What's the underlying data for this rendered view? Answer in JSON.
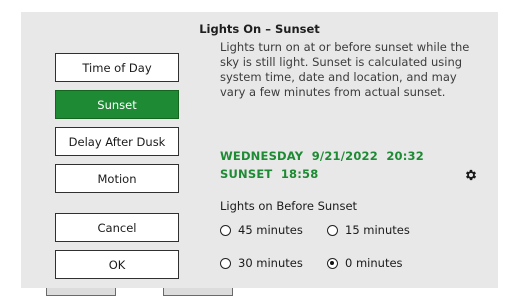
{
  "dialog": {
    "title": "Lights On – Sunset"
  },
  "mode_buttons": [
    {
      "label": "Time of Day",
      "selected": false
    },
    {
      "label": "Sunset",
      "selected": true
    },
    {
      "label": "Delay After Dusk",
      "selected": false
    },
    {
      "label": "Motion",
      "selected": false
    }
  ],
  "actions": {
    "cancel_label": "Cancel",
    "ok_label": "OK"
  },
  "description": "Lights turn on at or before sunset while the sky is still light. Sunset is calculated using system time, date and location, and may vary a few minutes from actual sunset.",
  "status": {
    "datetime": "WEDNESDAY  9/21/2022  20:32",
    "sunset": "SUNSET  18:58",
    "settings_icon": "gear-icon",
    "accent_color": "#1e8a34"
  },
  "before_sunset": {
    "heading": "Lights on Before Sunset",
    "options": [
      {
        "label": "45 minutes",
        "checked": false
      },
      {
        "label": "15 minutes",
        "checked": false
      },
      {
        "label": "30 minutes",
        "checked": false
      },
      {
        "label": "0 minutes",
        "checked": true
      }
    ]
  }
}
